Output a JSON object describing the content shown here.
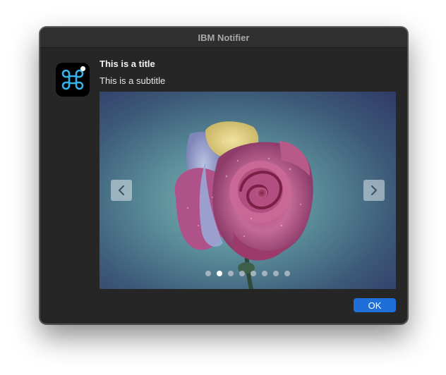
{
  "window": {
    "title": "IBM Notifier"
  },
  "notification": {
    "title": "This is a title",
    "subtitle": "This is a subtitle",
    "icon": "command-key-icon"
  },
  "carousel": {
    "image": "rose-photo",
    "prev_icon": "chevron-left-icon",
    "next_icon": "chevron-right-icon",
    "page_count": 8,
    "active_index": 1
  },
  "actions": {
    "ok_label": "OK"
  },
  "colors": {
    "accent": "#1f6fd8",
    "window_bg": "#262626",
    "icon_blue": "#37b0e6"
  }
}
